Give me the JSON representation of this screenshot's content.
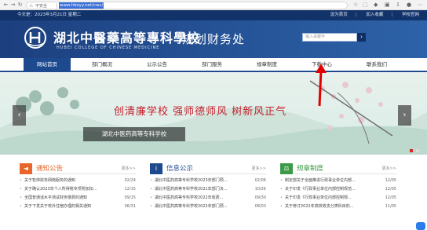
{
  "browser": {
    "security_label": "不安全",
    "url": "www.hbzyy.net/cwc/"
  },
  "top_info": {
    "date": "今天是：2023年3月21日 星期二",
    "links": [
      "设为首页",
      "加入收藏",
      "学校官网"
    ]
  },
  "header": {
    "school_name_cn": "湖北中醫藥高等專科學校",
    "school_name_en": "HUBEI COLLEGE OF CHINESE MEDICINE",
    "dept_title": "规划财务处",
    "search_placeholder": "输入关键字"
  },
  "nav": [
    {
      "label": "网站首页",
      "active": true
    },
    {
      "label": "部门概况",
      "active": false
    },
    {
      "label": "公示公告",
      "active": false
    },
    {
      "label": "部门服务",
      "active": false
    },
    {
      "label": "规章制度",
      "active": false
    },
    {
      "label": "下载中心",
      "active": false
    },
    {
      "label": "联系我们",
      "active": false
    }
  ],
  "banner": {
    "slogan": "创清廉学校  强师德师风  树新风正气",
    "caption": "湖北中医药高等专科学校"
  },
  "columns": [
    {
      "title": "通知公告",
      "icon": "megaphone-icon",
      "color": "#e8662a",
      "more": "更多>>",
      "items": [
        {
          "text": "关于暂停财务网络服务的通知",
          "date": "02/24"
        },
        {
          "text": "关于确认2023年个人所得税专项附加扣...",
          "date": "12/15"
        },
        {
          "text": "全国普通话水平测试财务缴费的通知",
          "date": "09/15"
        },
        {
          "text": "关于下发关于校外住宿办理的相关通知",
          "date": "06/31"
        }
      ]
    },
    {
      "title": "信息公示",
      "icon": "info-icon",
      "color": "#1d4a8e",
      "more": "更多>>",
      "items": [
        {
          "text": "湖北中医药高等专科学校2023年部门预...",
          "date": "02/06"
        },
        {
          "text": "湖北中医药高等专科学校2021年部门决...",
          "date": "10/26"
        },
        {
          "text": "湖北中医药高等专科学校2022年收费...",
          "date": "09/30"
        },
        {
          "text": "湖北中医药高等专科学校2022年部门预...",
          "date": "08/03"
        }
      ]
    },
    {
      "title": "规章制度",
      "icon": "scales-icon",
      "color": "#3c9a46",
      "more": "更多>>",
      "items": [
        {
          "text": "制定部关于全面推进行政事业单位内部...",
          "date": "12/05"
        },
        {
          "text": "关于印发《行政事业单位内部控制规范...",
          "date": "12/05"
        },
        {
          "text": "关于印发《行政事业单位内部控制规...",
          "date": "12/05"
        },
        {
          "text": "关于修订2022年高校收支分类科目的...",
          "date": "11/05"
        }
      ]
    }
  ]
}
